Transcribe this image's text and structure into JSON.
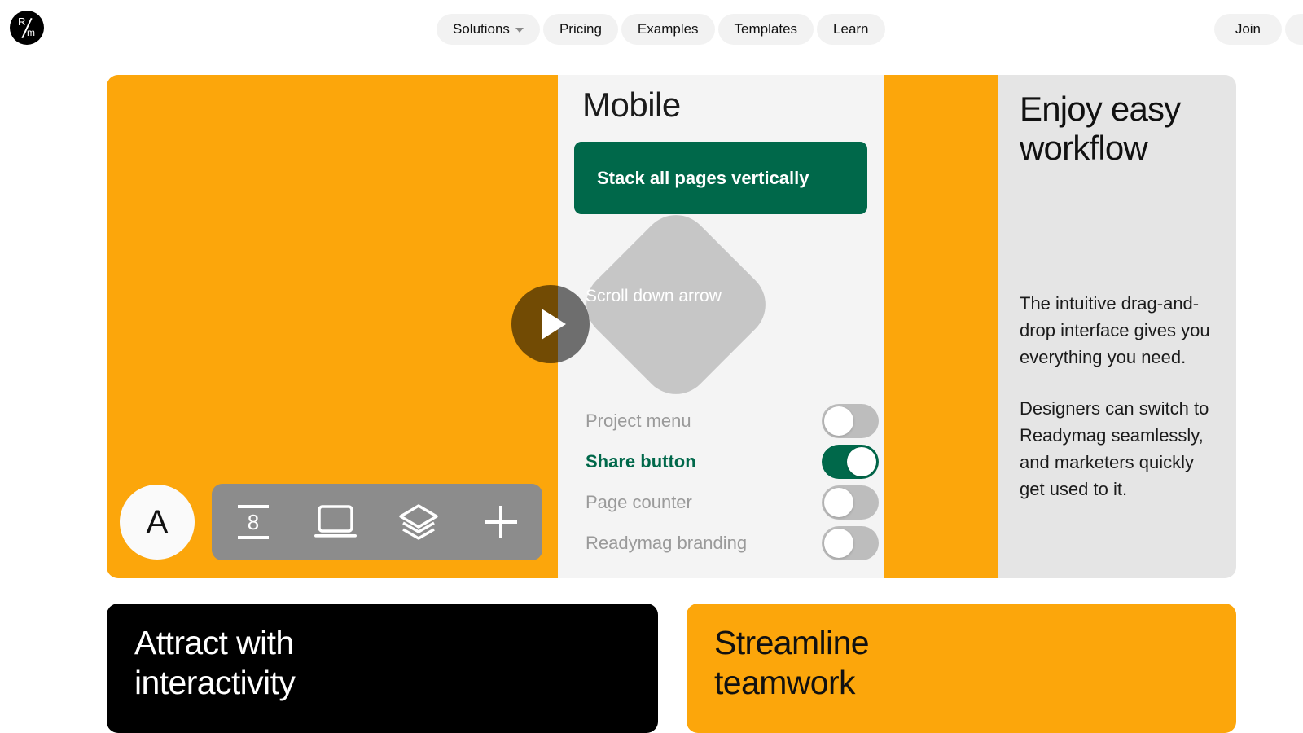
{
  "nav": {
    "logo": {
      "letter_top": "R",
      "letter_bottom": "m",
      "name": "readymag-logo"
    },
    "items": [
      {
        "label": "Solutions",
        "has_dropdown": true
      },
      {
        "label": "Pricing",
        "has_dropdown": false
      },
      {
        "label": "Examples",
        "has_dropdown": false
      },
      {
        "label": "Templates",
        "has_dropdown": false
      },
      {
        "label": "Learn",
        "has_dropdown": false
      }
    ],
    "join_label": "Join"
  },
  "hero": {
    "editor": {
      "section_title": "Mobile",
      "primary_action": "Stack all pages vertically",
      "diamond_label": "Scroll down arrow",
      "avatar_letter": "A",
      "toolbar_icons": [
        "pages-icon",
        "desktop-icon",
        "layers-icon",
        "plus-icon"
      ],
      "toggles": [
        {
          "label": "Project menu",
          "on": false
        },
        {
          "label": "Share button",
          "on": true
        },
        {
          "label": "Page counter",
          "on": false
        },
        {
          "label": "Readymag branding",
          "on": false
        }
      ]
    },
    "copy": {
      "heading": "Enjoy easy workflow",
      "paragraph_1": "The intuitive drag-and-drop interface gives you everything you need.",
      "paragraph_2": "Designers can switch to Readymag seamlessly, and marketers quickly get used to it."
    }
  },
  "cards": [
    {
      "title": "Attract with interactivity",
      "background": "#000000",
      "text_color": "#ffffff"
    },
    {
      "title": "Streamline teamwork",
      "background": "#fca60b",
      "text_color": "#111111"
    }
  ],
  "colors": {
    "brand_orange": "#fca60b",
    "accent_green": "#00684a",
    "panel_gray": "#f4f4f4",
    "panel_gray_dark": "#e5e5e5",
    "toolbar_gray": "#8c8c8c"
  }
}
